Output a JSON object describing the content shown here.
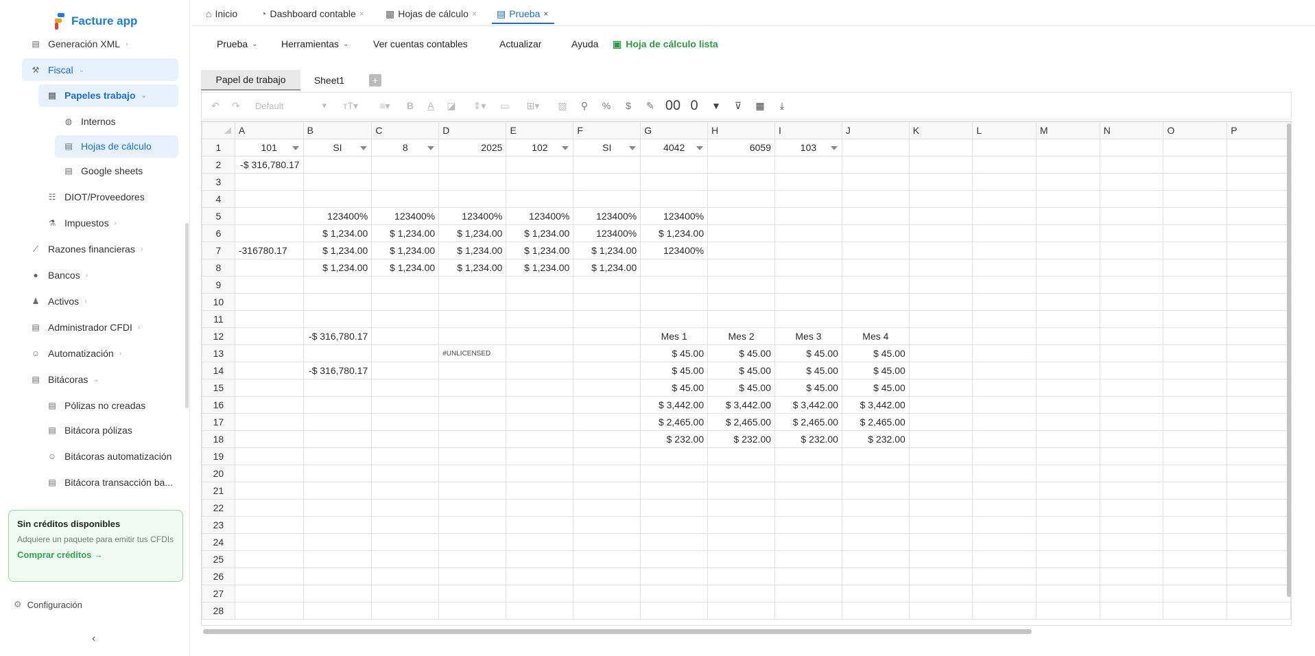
{
  "app": {
    "name": "Facture app"
  },
  "sidebar": {
    "items": [
      {
        "label": "Generación XML",
        "icon": "document-icon"
      },
      {
        "label": "Fiscal",
        "icon": "hammer-icon"
      },
      {
        "label": "Papeles trabajo",
        "icon": "sheet-icon"
      },
      {
        "label": "Internos",
        "icon": "database-icon"
      },
      {
        "label": "Hojas de cálculo",
        "icon": "sheet-icon"
      },
      {
        "label": "Google sheets",
        "icon": "document-icon"
      },
      {
        "label": "DIOT/Proveedores",
        "icon": "table-icon"
      },
      {
        "label": "Impuestos",
        "icon": "tax-icon"
      },
      {
        "label": "Razones financieras",
        "icon": "chart-icon"
      },
      {
        "label": "Bancos",
        "icon": "piggy-bank-icon"
      },
      {
        "label": "Activos",
        "icon": "assets-icon"
      },
      {
        "label": "Administrador CFDI",
        "icon": "document-icon"
      },
      {
        "label": "Automatización",
        "icon": "robot-icon"
      },
      {
        "label": "Bitácoras",
        "icon": "log-icon"
      },
      {
        "label": "Pólizas no creadas",
        "icon": "document-icon"
      },
      {
        "label": "Bitácora pólizas",
        "icon": "document-icon"
      },
      {
        "label": "Bitácoras automatización",
        "icon": "robot-icon"
      },
      {
        "label": "Bitácora transacción ba...",
        "icon": "document-icon"
      }
    ],
    "credits": {
      "title": "Sin créditos disponibles",
      "desc": "Adquiere un paquete para emitir tus CFDIs",
      "action": "Comprar créditos →"
    },
    "config": "Configuración"
  },
  "tabs": [
    {
      "label": "Inicio",
      "icon": "home-icon"
    },
    {
      "label": "Dashboard contable",
      "icon": "pie-chart-icon"
    },
    {
      "label": "Hojas de cálculo",
      "icon": "table-icon"
    },
    {
      "label": "Prueba",
      "icon": "sheet-icon"
    }
  ],
  "menubar": {
    "prueba": "Prueba",
    "herramientas": "Herramientas",
    "cuentas": "Ver cuentas contables",
    "actualizar": "Actualizar",
    "ayuda": "Ayuda",
    "ready": "Hoja de cálculo lista"
  },
  "sheet_tabs": [
    "Papel de trabajo",
    "Sheet1"
  ],
  "toolbar": {
    "font": "Default",
    "buttons": [
      "undo-icon",
      "redo-icon",
      "font-size-icon",
      "align-icon",
      "bold-icon",
      "text-color-icon",
      "fill-color-icon",
      "valign-icon",
      "merge-icon",
      "border-icon",
      "image-icon",
      "search-icon",
      "percent-icon",
      "currency-icon",
      "formula-icon",
      "decimal-increase-icon",
      "decimal-decrease-icon",
      "filter-icon",
      "clear-filter-icon",
      "calendar-icon",
      "download-icon"
    ],
    "decimal_more": "00",
    "decimal_less": "0",
    "percent": "%",
    "currency": "$"
  },
  "grid": {
    "columns": [
      "A",
      "B",
      "C",
      "D",
      "E",
      "F",
      "G",
      "H",
      "I",
      "J",
      "K",
      "L",
      "M",
      "N",
      "O",
      "P"
    ],
    "rows": [
      [
        "101",
        "SI",
        "8",
        "2025",
        "102",
        "SI",
        "4042",
        "6059",
        "103",
        "",
        "",
        "",
        "",
        "",
        "",
        ""
      ],
      [
        "-$ 316,780.17",
        "",
        "",
        "",
        "",
        "",
        "",
        "",
        "",
        "",
        "",
        "",
        "",
        "",
        "",
        ""
      ],
      [
        "",
        "",
        "",
        "",
        "",
        "",
        "",
        "",
        "",
        "",
        "",
        "",
        "",
        "",
        "",
        ""
      ],
      [
        "",
        "",
        "",
        "",
        "",
        "",
        "",
        "",
        "",
        "",
        "",
        "",
        "",
        "",
        "",
        ""
      ],
      [
        "",
        "123400%",
        "123400%",
        "123400%",
        "123400%",
        "123400%",
        "123400%",
        "",
        "",
        "",
        "",
        "",
        "",
        "",
        "",
        ""
      ],
      [
        "",
        "$ 1,234.00",
        "$ 1,234.00",
        "$ 1,234.00",
        "$ 1,234.00",
        "123400%",
        "$ 1,234.00",
        "",
        "",
        "",
        "",
        "",
        "",
        "",
        "",
        ""
      ],
      [
        "-316780.17",
        "$ 1,234.00",
        "$ 1,234.00",
        "$ 1,234.00",
        "$ 1,234.00",
        "$ 1,234.00",
        "123400%",
        "",
        "",
        "",
        "",
        "",
        "",
        "",
        "",
        ""
      ],
      [
        "",
        "$ 1,234.00",
        "$ 1,234.00",
        "$ 1,234.00",
        "$ 1,234.00",
        "$ 1,234.00",
        "",
        "",
        "",
        "",
        "",
        "",
        "",
        "",
        "",
        ""
      ],
      [
        "",
        "",
        "",
        "",
        "",
        "",
        "",
        "",
        "",
        "",
        "",
        "",
        "",
        "",
        "",
        ""
      ],
      [
        "",
        "",
        "",
        "",
        "",
        "",
        "",
        "",
        "",
        "",
        "",
        "",
        "",
        "",
        "",
        ""
      ],
      [
        "",
        "",
        "",
        "",
        "",
        "",
        "",
        "",
        "",
        "",
        "",
        "",
        "",
        "",
        "",
        ""
      ],
      [
        "",
        "-$ 316,780.17",
        "",
        "",
        "",
        "",
        "Mes 1",
        "Mes 2",
        "Mes 3",
        "Mes 4",
        "",
        "",
        "",
        "",
        "",
        ""
      ],
      [
        "",
        "",
        "",
        "#UNLICENSED",
        "",
        "",
        "$ 45.00",
        "$ 45.00",
        "$ 45.00",
        "$ 45.00",
        "",
        "",
        "",
        "",
        "",
        ""
      ],
      [
        "",
        "-$ 316,780.17",
        "",
        "",
        "",
        "",
        "$ 45.00",
        "$ 45.00",
        "$ 45.00",
        "$ 45.00",
        "",
        "",
        "",
        "",
        "",
        ""
      ],
      [
        "",
        "",
        "",
        "",
        "",
        "",
        "$ 45.00",
        "$ 45.00",
        "$ 45.00",
        "$ 45.00",
        "",
        "",
        "",
        "",
        "",
        ""
      ],
      [
        "",
        "",
        "",
        "",
        "",
        "",
        "$ 3,442.00",
        "$ 3,442.00",
        "$ 3,442.00",
        "$ 3,442.00",
        "",
        "",
        "",
        "",
        "",
        ""
      ],
      [
        "",
        "",
        "",
        "",
        "",
        "",
        "$ 2,465.00",
        "$ 2,465.00",
        "$ 2,465.00",
        "$ 2,465.00",
        "",
        "",
        "",
        "",
        "",
        ""
      ],
      [
        "",
        "",
        "",
        "",
        "",
        "",
        "$ 232.00",
        "$ 232.00",
        "$ 232.00",
        "$ 232.00",
        "",
        "",
        "",
        "",
        "",
        ""
      ],
      [
        "",
        "",
        "",
        "",
        "",
        "",
        "",
        "",
        "",
        "",
        "",
        "",
        "",
        "",
        "",
        ""
      ],
      [
        "",
        "",
        "",
        "",
        "",
        "",
        "",
        "",
        "",
        "",
        "",
        "",
        "",
        "",
        "",
        ""
      ],
      [
        "",
        "",
        "",
        "",
        "",
        "",
        "",
        "",
        "",
        "",
        "",
        "",
        "",
        "",
        "",
        ""
      ],
      [
        "",
        "",
        "",
        "",
        "",
        "",
        "",
        "",
        "",
        "",
        "",
        "",
        "",
        "",
        "",
        ""
      ],
      [
        "",
        "",
        "",
        "",
        "",
        "",
        "",
        "",
        "",
        "",
        "",
        "",
        "",
        "",
        "",
        ""
      ],
      [
        "",
        "",
        "",
        "",
        "",
        "",
        "",
        "",
        "",
        "",
        "",
        "",
        "",
        "",
        "",
        ""
      ],
      [
        "",
        "",
        "",
        "",
        "",
        "",
        "",
        "",
        "",
        "",
        "",
        "",
        "",
        "",
        "",
        ""
      ],
      [
        "",
        "",
        "",
        "",
        "",
        "",
        "",
        "",
        "",
        "",
        "",
        "",
        "",
        "",
        "",
        ""
      ],
      [
        "",
        "",
        "",
        "",
        "",
        "",
        "",
        "",
        "",
        "",
        "",
        "",
        "",
        "",
        "",
        ""
      ],
      [
        "",
        "",
        "",
        "",
        "",
        "",
        "",
        "",
        "",
        "",
        "",
        "",
        "",
        "",
        "",
        ""
      ]
    ]
  }
}
